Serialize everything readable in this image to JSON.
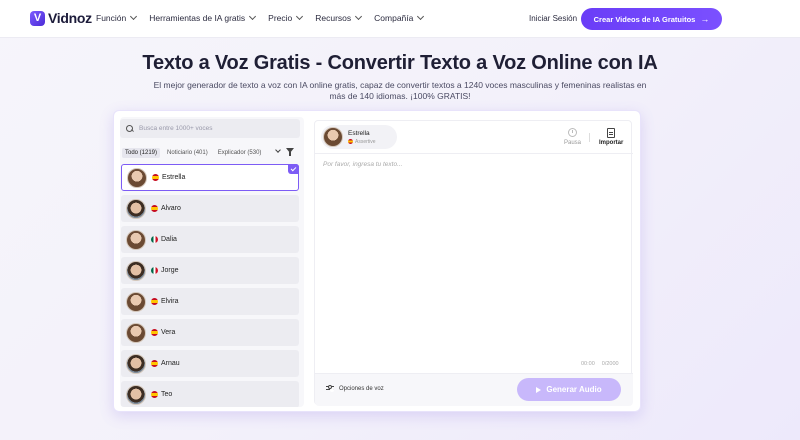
{
  "nav": {
    "logo_text": "Vidnoz",
    "logo_mark": "V",
    "menu": [
      {
        "label": "Función"
      },
      {
        "label": "Herramientas de IA gratis"
      },
      {
        "label": "Precio"
      },
      {
        "label": "Recursos"
      },
      {
        "label": "Compañía"
      }
    ],
    "login": "Iniciar Sesión",
    "cta": "Crear Videos de IA Gratuitos",
    "cta_icon": "arrow-right-icon"
  },
  "hero": {
    "title": "Texto a Voz Gratis - Convertir Texto a Voz Online con IA",
    "subtitle": "El mejor generador de texto a voz con IA online gratis, capaz de convertir textos a 1240 voces masculinas y femeninas realistas en más de 140 idiomas. ¡100% GRATIS!"
  },
  "voices_panel": {
    "search_placeholder": "Busca entre 1000+ voces",
    "filters": [
      {
        "label": "Todo (1219)",
        "active": true
      },
      {
        "label": "Noticiario (401)",
        "active": false
      },
      {
        "label": "Explicador (530)",
        "active": false
      }
    ],
    "voices": [
      {
        "name": "Estrella",
        "flag": "es",
        "gender": "f",
        "selected": true
      },
      {
        "name": "Alvaro",
        "flag": "es",
        "gender": "m",
        "selected": false
      },
      {
        "name": "Dalia",
        "flag": "mx",
        "gender": "f",
        "selected": false
      },
      {
        "name": "Jorge",
        "flag": "mx",
        "gender": "m",
        "selected": false
      },
      {
        "name": "Elvira",
        "flag": "es",
        "gender": "f",
        "selected": false
      },
      {
        "name": "Vera",
        "flag": "es",
        "gender": "f",
        "selected": false
      },
      {
        "name": "Arnau",
        "flag": "es",
        "gender": "m",
        "selected": false
      },
      {
        "name": "Teo",
        "flag": "es",
        "gender": "m",
        "selected": false
      }
    ]
  },
  "editor": {
    "current_voice": {
      "name": "Estrella",
      "style": "Assertive"
    },
    "pause_label": "Pausa",
    "import_label": "Importar",
    "text_placeholder": "Por favor, ingresa tu texto...",
    "time": "00:00",
    "char_count": "0/2000",
    "options_label": "Opciones de voz",
    "generate_label": "Generar Audio"
  },
  "colors": {
    "accent": "#6a3df7",
    "accent_disabled": "#c8b8fb"
  }
}
